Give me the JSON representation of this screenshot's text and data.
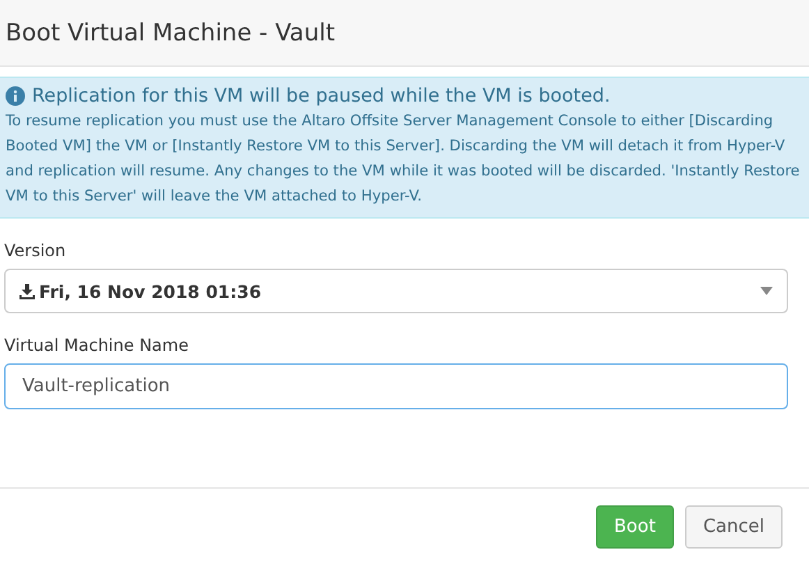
{
  "window": {
    "title": "Boot Virtual Machine - Vault"
  },
  "alert": {
    "heading": "Replication for this VM will be paused while the VM is booted.",
    "body": "To resume replication you must use the Altaro Offsite Server Management Console to either [Discarding Booted VM] the VM or [Instantly Restore VM to this Server]. Discarding the VM will detach it from Hyper-V and replication will resume. Any changes to the VM while it was booted will be discarded. 'Instantly Restore VM to this Server' will leave the VM attached to Hyper-V."
  },
  "version": {
    "label": "Version",
    "value": "Fri, 16 Nov 2018 01:36"
  },
  "vm_name": {
    "label": "Virtual Machine Name",
    "value": "Vault-replication"
  },
  "buttons": [
    {
      "label": "Boot",
      "kind": "primary"
    },
    {
      "label": "Cancel",
      "kind": "default"
    }
  ]
}
